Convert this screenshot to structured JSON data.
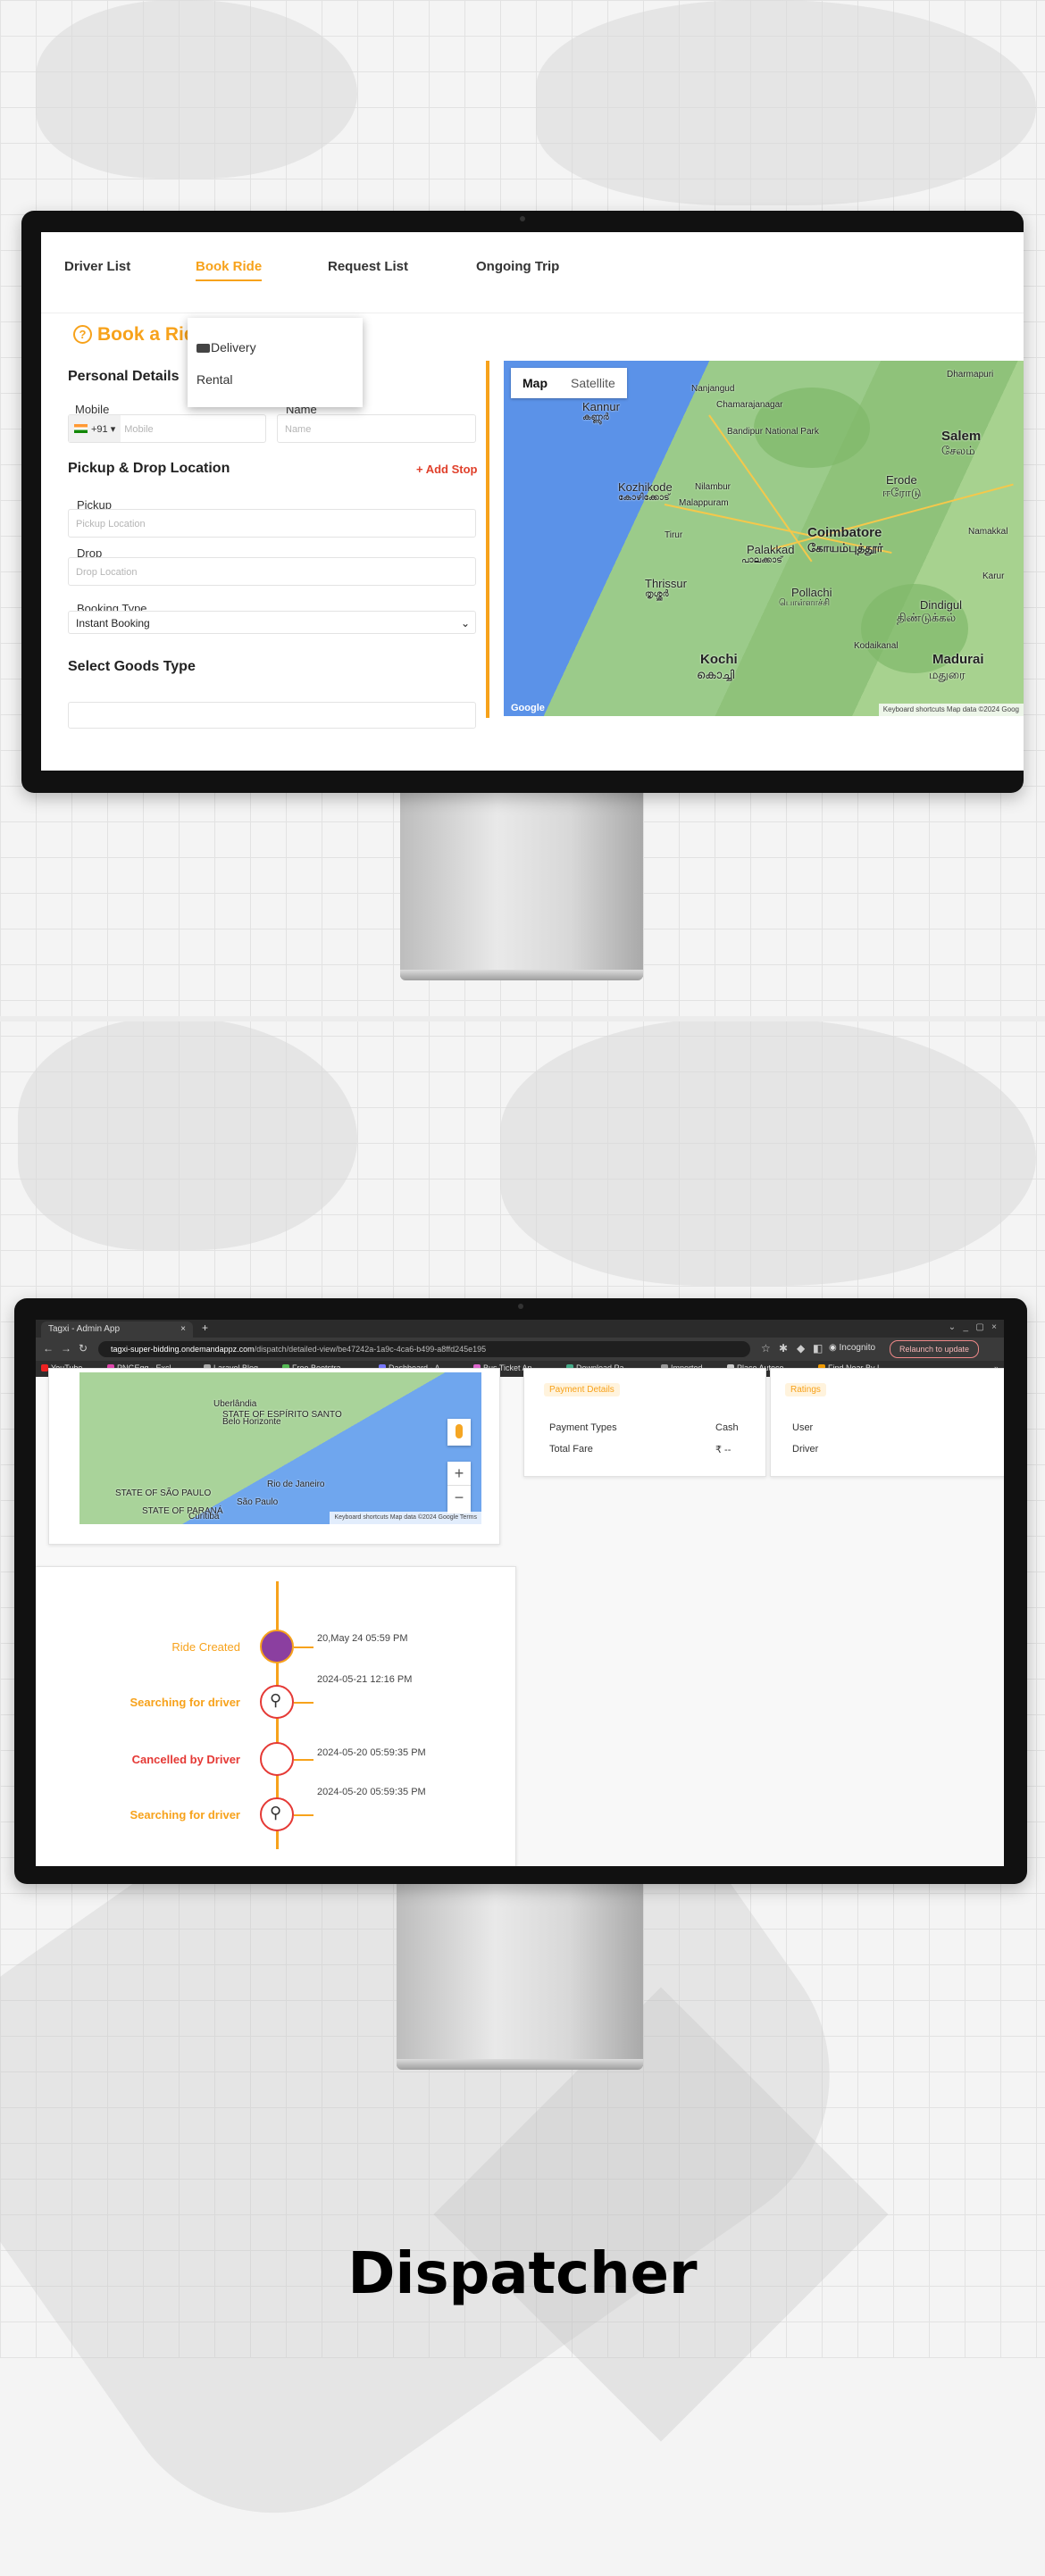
{
  "screen1": {
    "tabs": [
      "Driver List",
      "Book Ride",
      "Request List",
      "Ongoing Trip"
    ],
    "active_tab": "Book Ride",
    "page_title": "Book a Ride",
    "dropdown": {
      "items": [
        "Delivery",
        "Rental"
      ]
    },
    "personal_details": "Personal Details",
    "mobile_label": "Mobile",
    "country_code": "+91",
    "mobile_placeholder": "Mobile",
    "name_label": "Name",
    "name_placeholder": "Name",
    "location_heading": "Pickup & Drop Location",
    "add_stop": "+ Add Stop",
    "pickup_label": "Pickup",
    "pickup_placeholder": "Pickup Location",
    "drop_label": "Drop",
    "drop_placeholder": "Drop Location",
    "booking_type_label": "Booking Type",
    "booking_type_value": "Instant Booking",
    "goods_heading": "Select Goods Type",
    "map": {
      "toggle": [
        "Map",
        "Satellite"
      ],
      "places": [
        "Kannur",
        "കണ്ണൂർ",
        "Kozhikode",
        "കോഴിക്കോട്",
        "Thrissur",
        "തൃശ്ശൂർ",
        "Palakkad",
        "പാലക്കാട്",
        "Coimbatore",
        "கோயம்புத்தூர்",
        "Pollachi",
        "பொள்ளாச்சி",
        "Kochi",
        "കൊച്ചി",
        "Salem",
        "சேலம்",
        "Erode",
        "ஈரோடு",
        "Dindigul",
        "திண்டுக்கல்",
        "Madurai",
        "மதுரை",
        "Chamarajanagar",
        "Nanjangud",
        "Bandipur National Park",
        "Tirur",
        "Malappuram",
        "Nilambur",
        "Dharmapuri",
        "Namakkal",
        "Karur",
        "Kodaikanal"
      ],
      "footer": "Keyboard shortcuts   Map data ©2024 Goog"
    }
  },
  "screen2": {
    "browser_tab": "Tagxi - Admin App",
    "url_host": "tagxi-super-bidding.ondemandappz.com",
    "url_path": "/dispatch/detailed-view/be47242a-1a9c-4ca6-b499-a8ffd245e195",
    "incognito": "Incognito",
    "relaunch": "Relaunch to update",
    "bookmarks": [
      "YouTube",
      "PNGEgg - Excl...",
      "Laravel Blog",
      "Free Bootstra...",
      "Dashboard - A...",
      "Bus Ticket Ap...",
      "Download Pa...",
      "Imported",
      "Place Autoco...",
      "Find Near By L..."
    ],
    "map_places": [
      "Belo Horizonte",
      "Rio de Janeiro",
      "São Paulo",
      "Curitiba",
      "STATE OF SÃO PAULO",
      "STATE OF PARANÁ",
      "STATE OF ESPÍRITO SANTO"
    ],
    "map_footer": "Keyboard shortcuts   Map data ©2024 Google   Terms",
    "payment": {
      "badge": "Payment Details",
      "rows": [
        {
          "k": "Payment Types",
          "v": "Cash"
        },
        {
          "k": "Total Fare",
          "v": "₹ --"
        }
      ]
    },
    "ratings": {
      "badge": "Ratings",
      "rows": [
        "User",
        "Driver"
      ]
    },
    "timeline": [
      {
        "label": "Ride Created",
        "time": "20,May 24 05:59 PM",
        "color": "#f7a21b"
      },
      {
        "label": "Searching for driver",
        "time": "2024-05-21 12:16 PM",
        "color": "#f7a21b"
      },
      {
        "label": "Cancelled by Driver",
        "time": "2024-05-20 05:59:35 PM",
        "color": "#e53935"
      },
      {
        "label": "Searching for driver",
        "time": "2024-05-20 05:59:35 PM",
        "color": "#f7a21b"
      }
    ]
  },
  "footer_title": "Dispatcher"
}
